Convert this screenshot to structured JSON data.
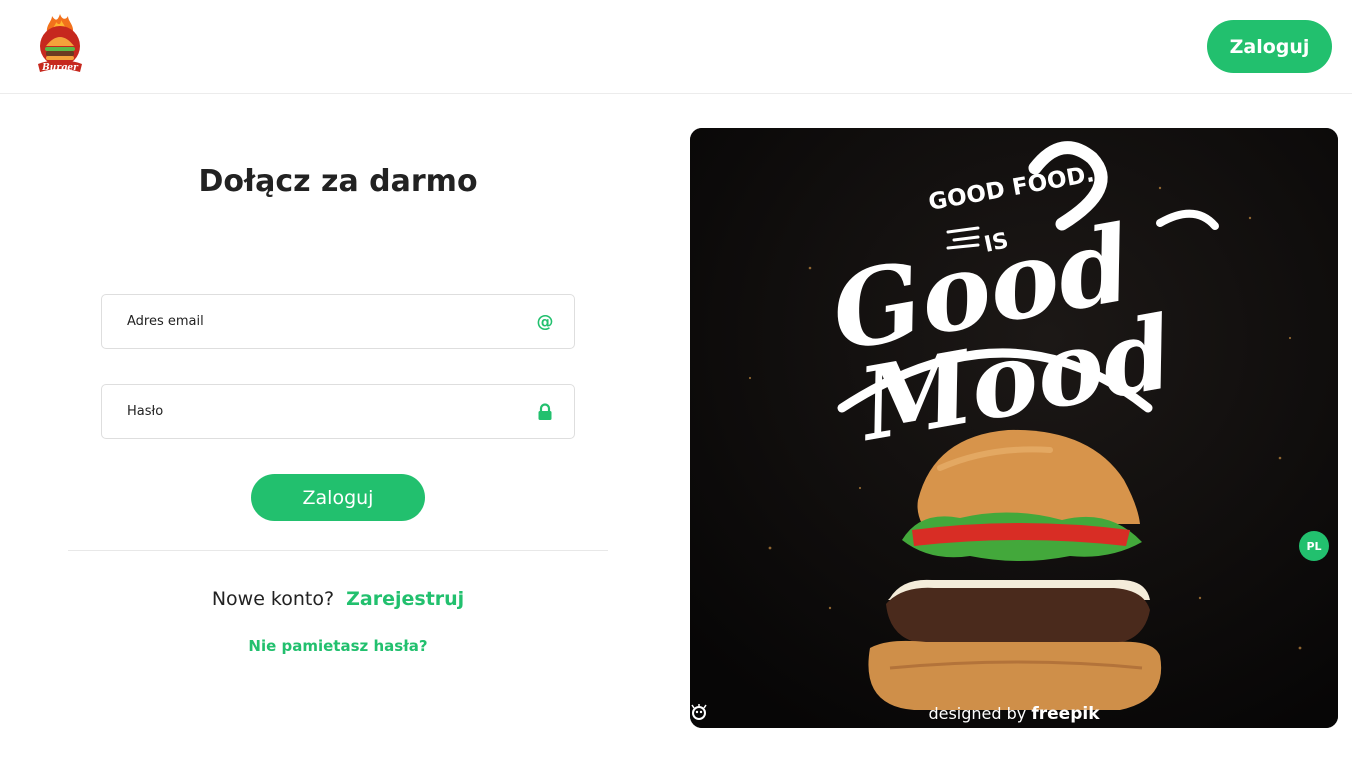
{
  "header": {
    "logo_text": "Burger",
    "login_label": "Zaloguj"
  },
  "form": {
    "title": "Dołącz za darmo",
    "email": {
      "placeholder": "Adres email",
      "icon": "at-icon"
    },
    "password": {
      "placeholder": "Hasło",
      "icon": "lock-icon"
    },
    "submit_label": "Zaloguj",
    "register_prompt": "Nowe konto?",
    "register_link": "Zarejestruj",
    "forgot_link": "Nie pamietasz hasła?"
  },
  "hero": {
    "lettering_top": "GOOD FOOD.",
    "lettering_is": "IS",
    "lettering_good": "Good",
    "lettering_mood": "Mood",
    "credit_prefix": "designed by",
    "credit_brand": "freepik"
  },
  "language": {
    "code": "PL"
  },
  "colors": {
    "accent": "#22c06e",
    "hero_background": "#0d0b0a"
  }
}
